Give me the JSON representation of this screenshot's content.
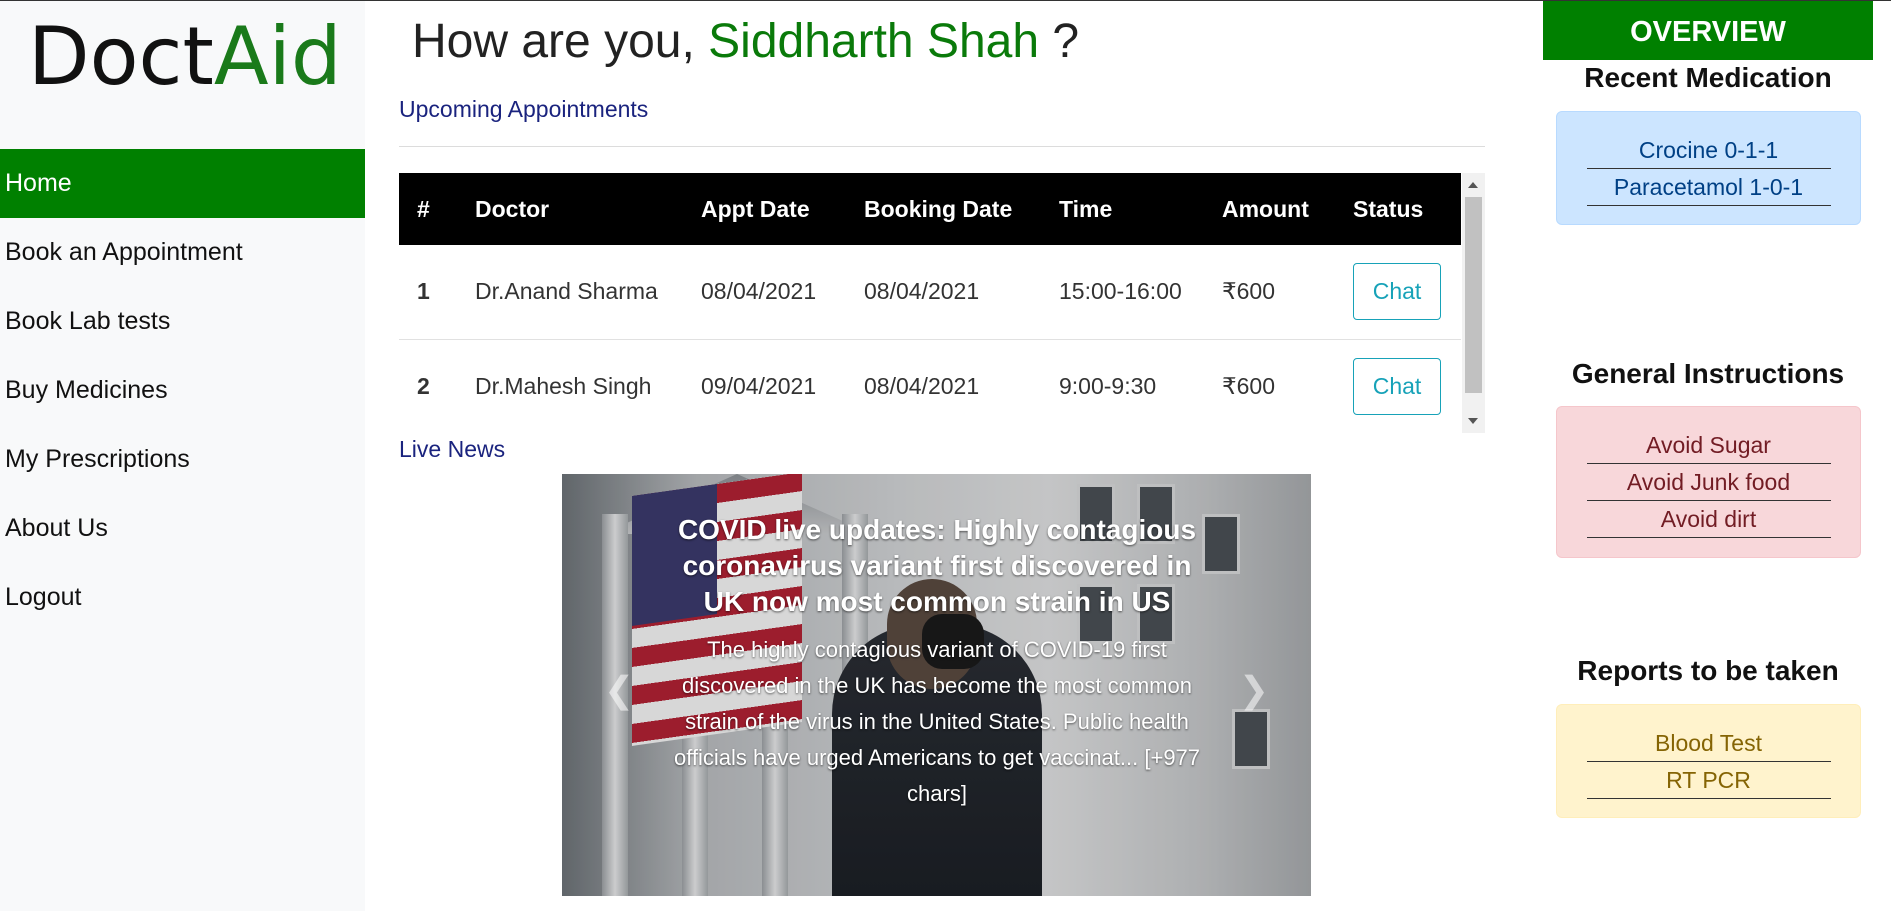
{
  "app": {
    "logo_part1": "Doct",
    "logo_part2": "Aid"
  },
  "sidebar": {
    "items": [
      {
        "label": "Home",
        "active": true
      },
      {
        "label": "Book an Appointment"
      },
      {
        "label": "Book Lab tests"
      },
      {
        "label": "Buy Medicines"
      },
      {
        "label": "My Prescriptions"
      },
      {
        "label": "About Us"
      },
      {
        "label": "Logout"
      }
    ]
  },
  "header": {
    "greeting_prefix": "How are you,",
    "user_name": "Siddharth Shah",
    "greeting_suffix": "?"
  },
  "appointments": {
    "section_title": "Upcoming Appointments",
    "columns": [
      "#",
      "Doctor",
      "Appt Date",
      "Booking Date",
      "Time",
      "Amount",
      "Status"
    ],
    "rows": [
      {
        "num": "1",
        "doctor": "Dr.Anand Sharma",
        "appt_date": "08/04/2021",
        "booking_date": "08/04/2021",
        "time": "15:00-16:00",
        "amount": "₹600",
        "status": "Chat"
      },
      {
        "num": "2",
        "doctor": "Dr.Mahesh Singh",
        "appt_date": "09/04/2021",
        "booking_date": "08/04/2021",
        "time": "9:00-9:30",
        "amount": "₹600",
        "status": "Chat"
      }
    ]
  },
  "news": {
    "section_title": "Live News",
    "headline": "COVID live updates: Highly contagious coronavirus variant first discovered in UK now most common strain in US",
    "summary": "The highly contagious variant of COVID-19 first discovered in the UK has become the most common strain of the virus in the United States. Public health officials have urged Americans to get vaccinat... [+977 chars]",
    "prev_icon": "chevron-left-icon",
    "next_icon": "chevron-right-icon"
  },
  "overview": {
    "title": "OVERVIEW",
    "recent_medication": {
      "title": "Recent Medication",
      "items": [
        "Crocine 0-1-1",
        "Paracetamol 1-0-1"
      ]
    },
    "general_instructions": {
      "title": "General Instructions",
      "items": [
        "Avoid Sugar",
        "Avoid Junk food",
        "Avoid dirt"
      ]
    },
    "reports": {
      "title": "Reports to be taken",
      "items": [
        "Blood Test",
        "RT PCR"
      ]
    }
  },
  "colors": {
    "brand_green": "#008000",
    "link_navy": "#1a237e",
    "chat_teal": "#17a2b8"
  }
}
